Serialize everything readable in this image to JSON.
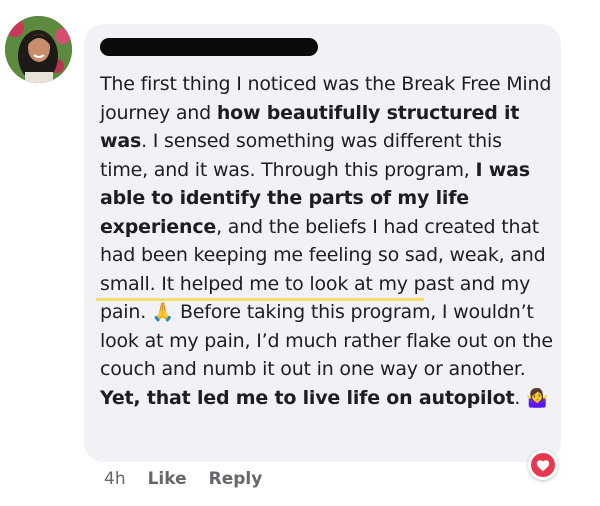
{
  "comment": {
    "author_name_redacted": true,
    "segments": [
      {
        "text": "The first thing I noticed was the Break Free Mind journey and ",
        "bold": false
      },
      {
        "text": "how beautifully structured it was",
        "bold": true
      },
      {
        "text": ". I sensed something was different this time, and it was. Through this program, ",
        "bold": false
      },
      {
        "text": "I was able to identify the parts of my life experience",
        "bold": true
      },
      {
        "text": ", and the beliefs I had created that had been keeping me feeling so sad, weak, and small. It helped me to look at my past and my pain. ",
        "bold": false
      },
      {
        "text": "🙏",
        "emoji": true
      },
      {
        "text": " Before taking this program, I wouldn’t look at my pain, I’d much rather flake out on the couch and numb it out in one way or another. ",
        "bold": false
      },
      {
        "text": "Yet, that led me to live life on autopilot",
        "bold": true
      },
      {
        "text": ". ",
        "bold": false
      },
      {
        "text": "🤷‍♀️",
        "emoji": true
      }
    ]
  },
  "actions": {
    "timestamp": "4h",
    "like_label": "Like",
    "reply_label": "Reply"
  },
  "reaction": {
    "icon": "heart-icon",
    "color": "#e8384f"
  },
  "colors": {
    "bubble": "#f0f2f5",
    "text": "#1c1e21",
    "meta": "#65676b",
    "highlight": "#f6de6a"
  }
}
